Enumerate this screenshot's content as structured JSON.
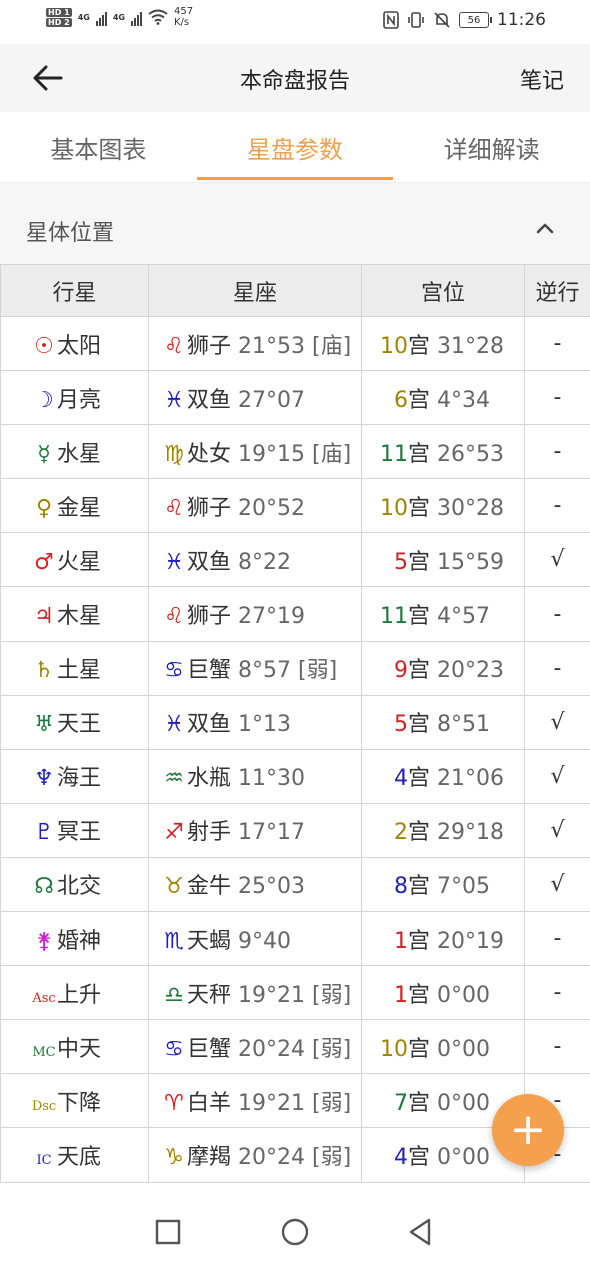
{
  "status_bar": {
    "hd1": "HD 1",
    "hd2": "HD 2",
    "net1": "4G",
    "net2": "4G",
    "speed_value": "457",
    "speed_unit": "K/s",
    "battery": "56",
    "time": "11:26"
  },
  "header": {
    "back_icon": "arrow-left-icon",
    "title": "本命盘报告",
    "notes_label": "笔记"
  },
  "tabs": [
    {
      "label": "基本图表",
      "active": false
    },
    {
      "label": "星盘参数",
      "active": true
    },
    {
      "label": "详细解读",
      "active": false
    }
  ],
  "section": {
    "title": "星体位置",
    "collapse_icon": "chevron-up-icon"
  },
  "table": {
    "headers": [
      "行星",
      "星座",
      "宫位",
      "逆行"
    ],
    "rows": [
      {
        "glyph": "☉",
        "glyph_color": "#d42020",
        "planet": "太阳",
        "sign_glyph": "♌",
        "sign_color": "#d42020",
        "sign": "狮子",
        "degree": "21°53 [庙]",
        "house": "10",
        "house_color": "#a08400",
        "house_label": "宫",
        "house_degree": "31°28",
        "retro": "-"
      },
      {
        "glyph": "☽",
        "glyph_color": "#2020c0",
        "planet": "月亮",
        "sign_glyph": "♓",
        "sign_color": "#2020c0",
        "sign": "双鱼",
        "degree": "27°07",
        "house": "6",
        "house_color": "#a08400",
        "house_label": "宫",
        "house_degree": "4°34",
        "retro": "-"
      },
      {
        "glyph": "☿",
        "glyph_color": "#1a7a3a",
        "planet": "水星",
        "sign_glyph": "♍",
        "sign_color": "#a08400",
        "sign": "处女",
        "degree": "19°15 [庙]",
        "house": "11",
        "house_color": "#1a7a3a",
        "house_label": "宫",
        "house_degree": "26°53",
        "retro": "-"
      },
      {
        "glyph": "♀",
        "glyph_color": "#a08400",
        "planet": "金星",
        "sign_glyph": "♌",
        "sign_color": "#d42020",
        "sign": "狮子",
        "degree": "20°52",
        "house": "10",
        "house_color": "#a08400",
        "house_label": "宫",
        "house_degree": "30°28",
        "retro": "-"
      },
      {
        "glyph": "♂",
        "glyph_color": "#d42020",
        "planet": "火星",
        "sign_glyph": "♓",
        "sign_color": "#2020c0",
        "sign": "双鱼",
        "degree": "8°22",
        "house": "5",
        "house_color": "#d42020",
        "house_label": "宫",
        "house_degree": "15°59",
        "retro": "√"
      },
      {
        "glyph": "♃",
        "glyph_color": "#d42020",
        "planet": "木星",
        "sign_glyph": "♌",
        "sign_color": "#d42020",
        "sign": "狮子",
        "degree": "27°19",
        "house": "11",
        "house_color": "#1a7a3a",
        "house_label": "宫",
        "house_degree": "4°57",
        "retro": "-"
      },
      {
        "glyph": "♄",
        "glyph_color": "#a08400",
        "planet": "土星",
        "sign_glyph": "♋",
        "sign_color": "#2020c0",
        "sign": "巨蟹",
        "degree": "8°57 [弱]",
        "house": "9",
        "house_color": "#d42020",
        "house_label": "宫",
        "house_degree": "20°23",
        "retro": "-"
      },
      {
        "glyph": "♅",
        "glyph_color": "#1a7a3a",
        "planet": "天王",
        "sign_glyph": "♓",
        "sign_color": "#2020c0",
        "sign": "双鱼",
        "degree": "1°13",
        "house": "5",
        "house_color": "#d42020",
        "house_label": "宫",
        "house_degree": "8°51",
        "retro": "√"
      },
      {
        "glyph": "♆",
        "glyph_color": "#2020c0",
        "planet": "海王",
        "sign_glyph": "♒",
        "sign_color": "#1a7a3a",
        "sign": "水瓶",
        "degree": "11°30",
        "house": "4",
        "house_color": "#2020c0",
        "house_label": "宫",
        "house_degree": "21°06",
        "retro": "√"
      },
      {
        "glyph": "♇",
        "glyph_color": "#2020c0",
        "planet": "冥王",
        "sign_glyph": "♐",
        "sign_color": "#d42020",
        "sign": "射手",
        "degree": "17°17",
        "house": "2",
        "house_color": "#a08400",
        "house_label": "宫",
        "house_degree": "29°18",
        "retro": "√"
      },
      {
        "glyph": "☊",
        "glyph_color": "#1a7a3a",
        "planet": "北交",
        "sign_glyph": "♉",
        "sign_color": "#a08400",
        "sign": "金牛",
        "degree": "25°03",
        "house": "8",
        "house_color": "#2020c0",
        "house_label": "宫",
        "house_degree": "7°05",
        "retro": "√"
      },
      {
        "glyph": "⚵",
        "glyph_color": "#d020d0",
        "planet": "婚神",
        "sign_glyph": "♏",
        "sign_color": "#2020c0",
        "sign": "天蝎",
        "degree": "9°40",
        "house": "1",
        "house_color": "#d42020",
        "house_label": "宫",
        "house_degree": "20°19",
        "retro": "-"
      },
      {
        "glyph": "Asc",
        "glyph_color": "#d42020",
        "planet": "上升",
        "sign_glyph": "♎",
        "sign_color": "#1a7a3a",
        "sign": "天秤",
        "degree": "19°21 [弱]",
        "house": "1",
        "house_color": "#d42020",
        "house_label": "宫",
        "house_degree": "0°00",
        "retro": "-"
      },
      {
        "glyph": "MC",
        "glyph_color": "#1a7a3a",
        "planet": "中天",
        "sign_glyph": "♋",
        "sign_color": "#2020c0",
        "sign": "巨蟹",
        "degree": "20°24 [弱]",
        "house": "10",
        "house_color": "#a08400",
        "house_label": "宫",
        "house_degree": "0°00",
        "retro": "-"
      },
      {
        "glyph": "Dsc",
        "glyph_color": "#a08400",
        "planet": "下降",
        "sign_glyph": "♈",
        "sign_color": "#d42020",
        "sign": "白羊",
        "degree": "19°21 [弱]",
        "house": "7",
        "house_color": "#1a7a3a",
        "house_label": "宫",
        "house_degree": "0°00",
        "retro": "-"
      },
      {
        "glyph": "IC",
        "glyph_color": "#2020c0",
        "planet": "天底",
        "sign_glyph": "♑",
        "sign_color": "#a08400",
        "sign": "摩羯",
        "degree": "20°24 [弱]",
        "house": "4",
        "house_color": "#2020c0",
        "house_label": "宫",
        "house_degree": "0°00",
        "retro": "-"
      }
    ]
  },
  "fab": {
    "label": "+",
    "icon": "plus-icon"
  },
  "nav_bar": {
    "icons": [
      "square-recents-icon",
      "circle-home-icon",
      "triangle-back-icon"
    ]
  }
}
